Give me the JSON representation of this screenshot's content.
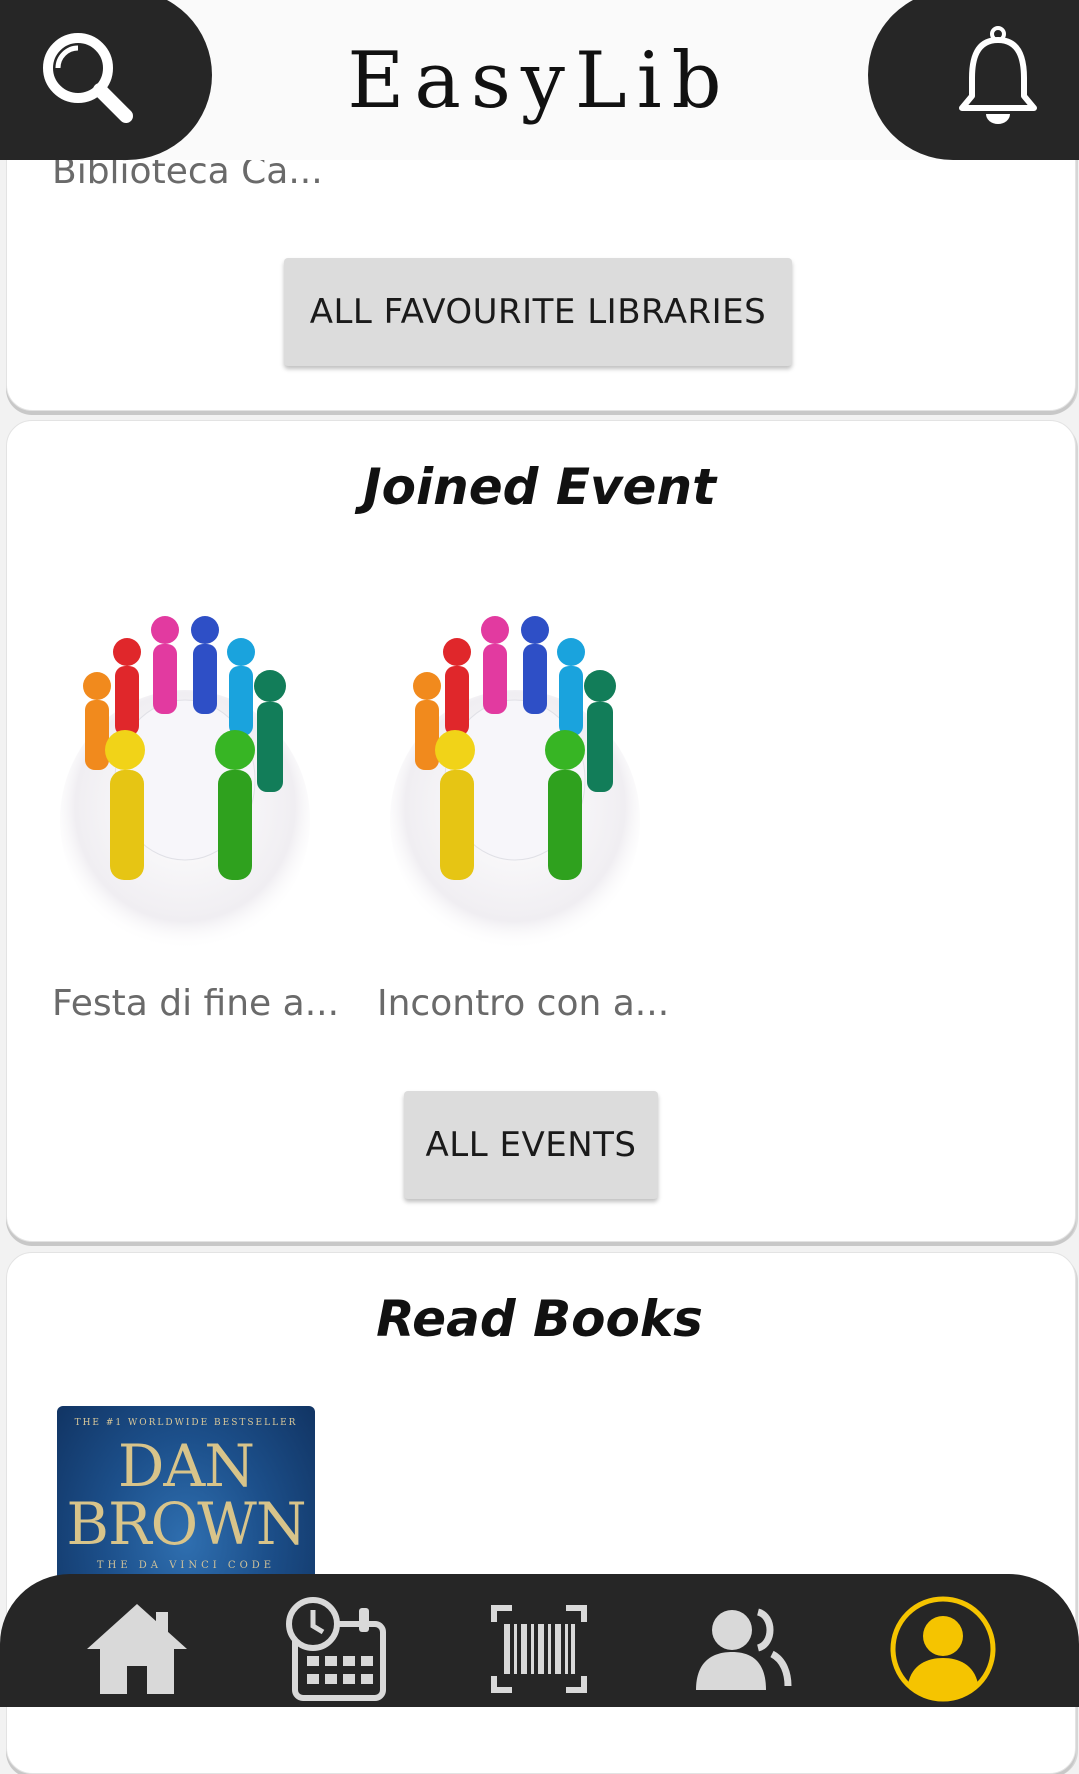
{
  "header": {
    "app_title": "EasyLib",
    "search_icon": "search-icon",
    "bell_icon": "bell-icon"
  },
  "favourite_libraries": {
    "items": [
      {
        "name": "Biblioteca Ca..."
      }
    ],
    "all_button_label": "ALL FAVOURITE LIBRARIES"
  },
  "joined_events": {
    "title": "Joined Event",
    "items": [
      {
        "name": "Festa di fine a..."
      },
      {
        "name": "Incontro con a..."
      }
    ],
    "all_button_label": "ALL EVENTS"
  },
  "read_books": {
    "title": "Read Books",
    "items": [
      {
        "cover_tag": "THE #1 WORLDWIDE BESTSELLER",
        "cover_author_line1": "DAN",
        "cover_author_line2": "BROWN",
        "cover_subtitle": "THE DA VINCI CODE"
      }
    ]
  },
  "bottom_nav": {
    "items": [
      {
        "icon": "home-icon"
      },
      {
        "icon": "calendar-clock-icon"
      },
      {
        "icon": "barcode-icon"
      },
      {
        "icon": "community-icon"
      },
      {
        "icon": "profile-icon",
        "active": true
      }
    ],
    "active_color": "#f5c400",
    "bar_color": "#262626"
  }
}
